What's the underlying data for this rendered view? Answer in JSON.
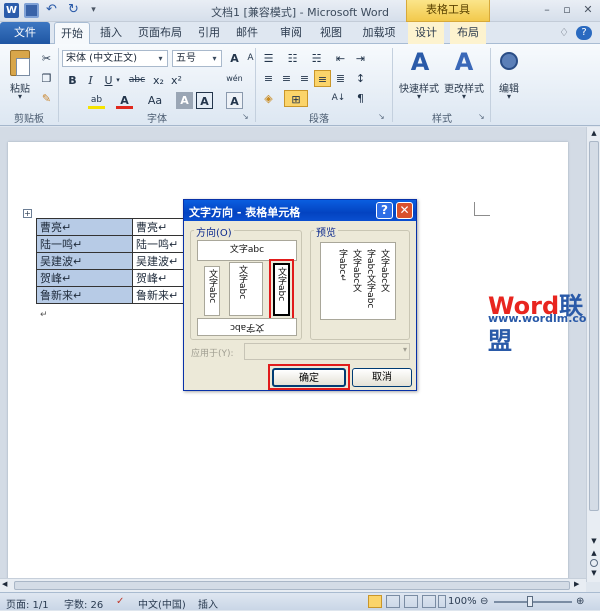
{
  "window": {
    "title": "文档1 [兼容模式] - Microsoft Word",
    "context_tab": "表格工具",
    "controls": [
      "–",
      "▫",
      "✕"
    ],
    "sub_controls": [
      "♢",
      "?"
    ]
  },
  "tabs": [
    "文件",
    "开始",
    "插入",
    "页面布局",
    "引用",
    "邮件",
    "审阅",
    "视图",
    "加载项",
    "设计",
    "布局"
  ],
  "ribbon": {
    "clipboard": {
      "paste": "粘贴",
      "label": "剪贴板"
    },
    "font": {
      "name": "宋体 (中文正文)",
      "size": "五号",
      "grow": "A",
      "shrink": "A",
      "wen": "wén",
      "clear": "A",
      "bold": "B",
      "italic": "I",
      "underline": "U",
      "strike": "abc",
      "sub": "x₂",
      "sup": "x²",
      "highlight": "ab",
      "color": "A",
      "case": "Aa",
      "label": "字体"
    },
    "paragraph": {
      "label": "段落"
    },
    "styles": {
      "quick": "快速样式",
      "change": "更改样式",
      "label": "样式"
    },
    "editing": {
      "label": "编辑"
    }
  },
  "doc_table": {
    "rows": [
      [
        "曹亮↵",
        "曹亮↵"
      ],
      [
        "陆一鸣↵",
        "陆一鸣↵"
      ],
      [
        "吴建波↵",
        "吴建波↵"
      ],
      [
        "贺峰↵",
        "贺峰↵"
      ],
      [
        "鲁新来↵",
        "鲁新来↵"
      ]
    ],
    "after_mark": "↵"
  },
  "dialog": {
    "title": "文字方向 - 表格单元格",
    "help": "?",
    "close": "✕",
    "direction_label": "方向(O)",
    "preview_label": "预览",
    "orientation_samples": [
      "文字abc",
      "文字abc",
      "文字abc",
      "文字abc",
      "文字abc"
    ],
    "preview_text": [
      "文字abc文",
      "字abc文字abc",
      "文字abc文",
      "字abc↵"
    ],
    "apply_label": "应用于(Y):",
    "ok": "确定",
    "cancel": "取消"
  },
  "watermark": {
    "logo_a": "Word",
    "logo_b": "联盟",
    "url": "www.wordlm.com"
  },
  "status": {
    "page": "页面: 1/1",
    "words": "字数: 26",
    "lang": "中文(中国)",
    "mode": "插入",
    "zoom": "100%"
  }
}
